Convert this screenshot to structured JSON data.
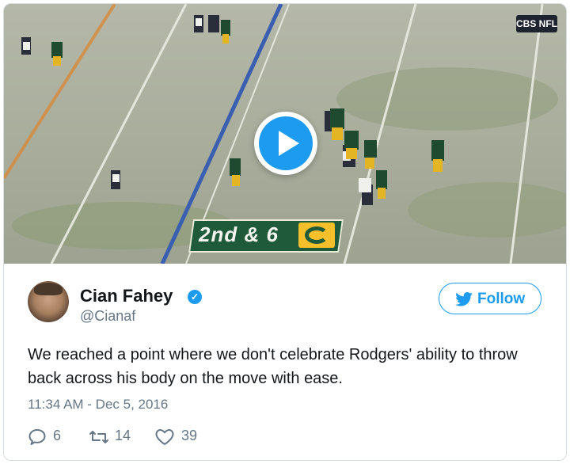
{
  "media": {
    "network_logo": "CBS NFL",
    "down_and_distance": "2nd & 6",
    "team_logo_icon": "g-logo-icon",
    "play_icon": "play-icon"
  },
  "author": {
    "name": "Cian Fahey",
    "handle": "@Cianaf",
    "verified_icon": "verified-badge-icon"
  },
  "follow_button": {
    "label": "Follow",
    "icon": "twitter-bird-icon"
  },
  "tweet": {
    "text": "We reached a point where we don't celebrate Rodgers' ability to throw back across his body on the move with ease.",
    "timestamp": "11:34 AM - Dec 5, 2016"
  },
  "actions": {
    "replies": "6",
    "retweets": "14",
    "likes": "39"
  },
  "colors": {
    "accent": "#1d9bf0",
    "text": "#14171a",
    "muted": "#657786"
  }
}
